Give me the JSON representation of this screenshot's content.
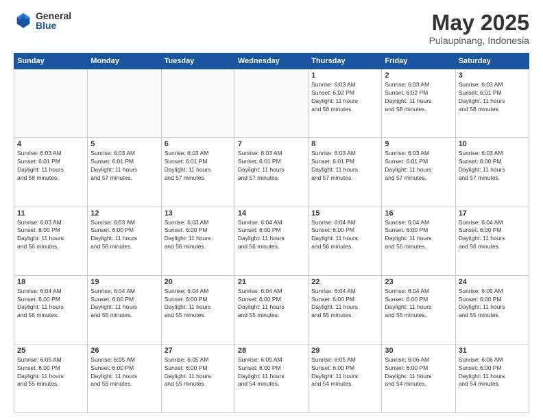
{
  "logo": {
    "general": "General",
    "blue": "Blue"
  },
  "header": {
    "month": "May 2025",
    "location": "Pulaupinang, Indonesia"
  },
  "weekdays": [
    "Sunday",
    "Monday",
    "Tuesday",
    "Wednesday",
    "Thursday",
    "Friday",
    "Saturday"
  ],
  "weeks": [
    [
      {
        "day": "",
        "info": ""
      },
      {
        "day": "",
        "info": ""
      },
      {
        "day": "",
        "info": ""
      },
      {
        "day": "",
        "info": ""
      },
      {
        "day": "1",
        "info": "Sunrise: 6:03 AM\nSunset: 6:02 PM\nDaylight: 11 hours\nand 58 minutes."
      },
      {
        "day": "2",
        "info": "Sunrise: 6:03 AM\nSunset: 6:02 PM\nDaylight: 11 hours\nand 58 minutes."
      },
      {
        "day": "3",
        "info": "Sunrise: 6:03 AM\nSunset: 6:01 PM\nDaylight: 11 hours\nand 58 minutes."
      }
    ],
    [
      {
        "day": "4",
        "info": "Sunrise: 6:03 AM\nSunset: 6:01 PM\nDaylight: 11 hours\nand 58 minutes."
      },
      {
        "day": "5",
        "info": "Sunrise: 6:03 AM\nSunset: 6:01 PM\nDaylight: 11 hours\nand 57 minutes."
      },
      {
        "day": "6",
        "info": "Sunrise: 6:03 AM\nSunset: 6:01 PM\nDaylight: 11 hours\nand 57 minutes."
      },
      {
        "day": "7",
        "info": "Sunrise: 6:03 AM\nSunset: 6:01 PM\nDaylight: 11 hours\nand 57 minutes."
      },
      {
        "day": "8",
        "info": "Sunrise: 6:03 AM\nSunset: 6:01 PM\nDaylight: 11 hours\nand 57 minutes."
      },
      {
        "day": "9",
        "info": "Sunrise: 6:03 AM\nSunset: 6:01 PM\nDaylight: 11 hours\nand 57 minutes."
      },
      {
        "day": "10",
        "info": "Sunrise: 6:03 AM\nSunset: 6:00 PM\nDaylight: 11 hours\nand 57 minutes."
      }
    ],
    [
      {
        "day": "11",
        "info": "Sunrise: 6:03 AM\nSunset: 6:00 PM\nDaylight: 11 hours\nand 56 minutes."
      },
      {
        "day": "12",
        "info": "Sunrise: 6:03 AM\nSunset: 6:00 PM\nDaylight: 11 hours\nand 56 minutes."
      },
      {
        "day": "13",
        "info": "Sunrise: 6:03 AM\nSunset: 6:00 PM\nDaylight: 11 hours\nand 56 minutes."
      },
      {
        "day": "14",
        "info": "Sunrise: 6:04 AM\nSunset: 6:00 PM\nDaylight: 11 hours\nand 56 minutes."
      },
      {
        "day": "15",
        "info": "Sunrise: 6:04 AM\nSunset: 6:00 PM\nDaylight: 11 hours\nand 56 minutes."
      },
      {
        "day": "16",
        "info": "Sunrise: 6:04 AM\nSunset: 6:00 PM\nDaylight: 11 hours\nand 56 minutes."
      },
      {
        "day": "17",
        "info": "Sunrise: 6:04 AM\nSunset: 6:00 PM\nDaylight: 11 hours\nand 56 minutes."
      }
    ],
    [
      {
        "day": "18",
        "info": "Sunrise: 6:04 AM\nSunset: 6:00 PM\nDaylight: 11 hours\nand 56 minutes."
      },
      {
        "day": "19",
        "info": "Sunrise: 6:04 AM\nSunset: 6:00 PM\nDaylight: 11 hours\nand 55 minutes."
      },
      {
        "day": "20",
        "info": "Sunrise: 6:04 AM\nSunset: 6:00 PM\nDaylight: 11 hours\nand 55 minutes."
      },
      {
        "day": "21",
        "info": "Sunrise: 6:04 AM\nSunset: 6:00 PM\nDaylight: 11 hours\nand 55 minutes."
      },
      {
        "day": "22",
        "info": "Sunrise: 6:04 AM\nSunset: 6:00 PM\nDaylight: 11 hours\nand 55 minutes."
      },
      {
        "day": "23",
        "info": "Sunrise: 6:04 AM\nSunset: 6:00 PM\nDaylight: 11 hours\nand 55 minutes."
      },
      {
        "day": "24",
        "info": "Sunrise: 6:05 AM\nSunset: 6:00 PM\nDaylight: 11 hours\nand 55 minutes."
      }
    ],
    [
      {
        "day": "25",
        "info": "Sunrise: 6:05 AM\nSunset: 6:00 PM\nDaylight: 11 hours\nand 55 minutes."
      },
      {
        "day": "26",
        "info": "Sunrise: 6:05 AM\nSunset: 6:00 PM\nDaylight: 11 hours\nand 55 minutes."
      },
      {
        "day": "27",
        "info": "Sunrise: 6:05 AM\nSunset: 6:00 PM\nDaylight: 11 hours\nand 55 minutes."
      },
      {
        "day": "28",
        "info": "Sunrise: 6:05 AM\nSunset: 6:00 PM\nDaylight: 11 hours\nand 54 minutes."
      },
      {
        "day": "29",
        "info": "Sunrise: 6:05 AM\nSunset: 6:00 PM\nDaylight: 11 hours\nand 54 minutes."
      },
      {
        "day": "30",
        "info": "Sunrise: 6:06 AM\nSunset: 6:00 PM\nDaylight: 11 hours\nand 54 minutes."
      },
      {
        "day": "31",
        "info": "Sunrise: 6:06 AM\nSunset: 6:00 PM\nDaylight: 11 hours\nand 54 minutes."
      }
    ]
  ]
}
